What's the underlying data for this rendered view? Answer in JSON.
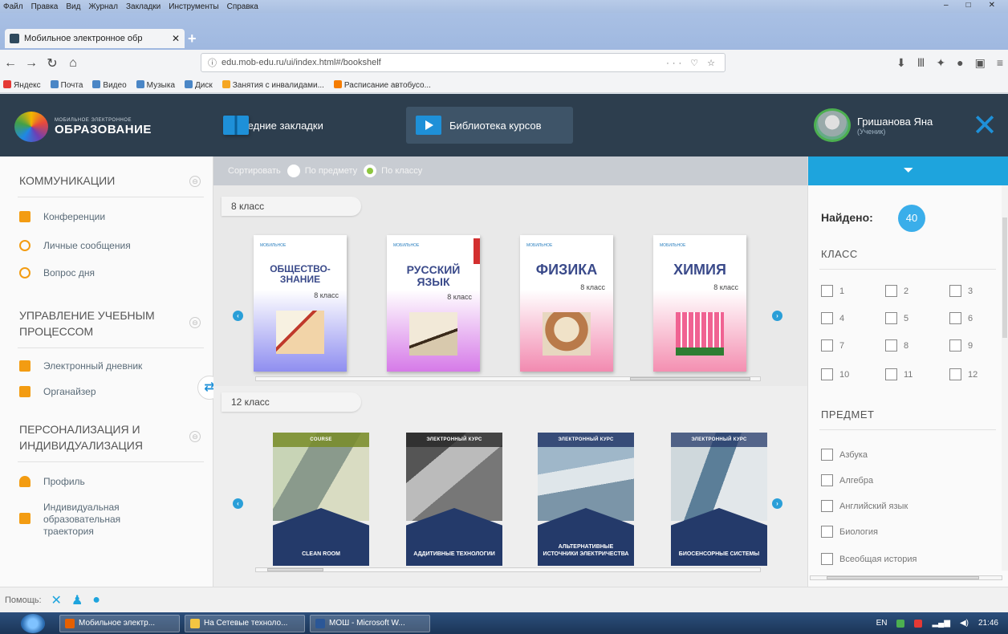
{
  "browser": {
    "menu": [
      "Файл",
      "Правка",
      "Вид",
      "Журнал",
      "Закладки",
      "Инструменты",
      "Справка"
    ],
    "tab_title": "Мобильное электронное обр",
    "url": "edu.mob-edu.ru/ui/index.html#/bookshelf",
    "bookmarks": [
      "Яндекс",
      "Почта",
      "Видео",
      "Музыка",
      "Диск",
      "Занятия с инвалидами...",
      "Расписание автобусо..."
    ]
  },
  "app": {
    "logo_small": "МОБИЛЬНОЕ ЭЛЕКТРОННОЕ",
    "logo_big": "ОБРАЗОВАНИЕ",
    "nav_recent": "Последние закладки",
    "nav_library": "Библиотека курсов",
    "user_name": "Гришанова Яна",
    "user_role": "(Ученик)"
  },
  "sidebar": {
    "sec1": "КОММУНИКАЦИИ",
    "conferences": "Конференции",
    "messages": "Личные сообщения",
    "question": "Вопрос дня",
    "sec2_l1": "УПРАВЛЕНИЕ УЧЕБНЫМ",
    "sec2_l2": "ПРОЦЕССОМ",
    "diary": "Электронный дневник",
    "organizer": "Органайзер",
    "sec3_l1": "ПЕРСОНАЛИЗАЦИЯ И",
    "sec3_l2": "ИНДИВИДУАЛИЗАЦИЯ",
    "profile": "Профиль",
    "trajectory_l1": "Индивидуальная",
    "trajectory_l2": "образовательная",
    "trajectory_l3": "траектория"
  },
  "sort": {
    "label": "Сортировать",
    "by_subject": "По предмету",
    "by_class": "По классу"
  },
  "shelves": {
    "grade8": {
      "label": "8 класс",
      "books": [
        {
          "l1": "ОБЩЕСТВО-",
          "l2": "ЗНАНИЕ",
          "grade": "8 класс",
          "pub": "МОБИЛЬНОЕ"
        },
        {
          "l1": "РУССКИЙ",
          "l2": "ЯЗЫК",
          "grade": "8 класс",
          "pub": "МОБИЛЬНОЕ"
        },
        {
          "l1": "ФИЗИКА",
          "l2": "",
          "grade": "8 класс",
          "pub": "МОБИЛЬНОЕ"
        },
        {
          "l1": "ХИМИЯ",
          "l2": "",
          "grade": "8 класс",
          "pub": "МОБИЛЬНОЕ"
        }
      ]
    },
    "grade12": {
      "label": "12 класс",
      "courses": [
        {
          "top": "COURSE",
          "title": "CLEAN ROOM"
        },
        {
          "top": "ЭЛЕКТРОННЫЙ КУРС",
          "title": "АДДИТИВНЫЕ ТЕХНОЛОГИИ"
        },
        {
          "top": "ЭЛЕКТРОННЫЙ КУРС",
          "title": "АЛЬТЕРНАТИВНЫЕ ИСТОЧНИКИ ЭЛЕКТРИЧЕСТВА"
        },
        {
          "top": "ЭЛЕКТРОННЫЙ КУРС",
          "title": "БИОСЕНСОРНЫЕ СИСТЕМЫ"
        }
      ]
    }
  },
  "filters": {
    "found_label": "Найдено:",
    "found_count": "40",
    "class_title": "КЛАСС",
    "classes": [
      "1",
      "2",
      "3",
      "4",
      "5",
      "6",
      "7",
      "8",
      "9",
      "10",
      "11",
      "12"
    ],
    "subject_title": "ПРЕДМЕТ",
    "subjects": [
      "Азбука",
      "Алгебра",
      "Английский язык",
      "Биология",
      "Всеобщая история"
    ]
  },
  "footer": {
    "help": "Помощь:"
  },
  "taskbar": {
    "tasks": [
      "Мобильное электр...",
      "На Сетевые техноло...",
      "МОШ - Microsoft W..."
    ],
    "lang": "EN",
    "time": "21:46"
  },
  "colors": {
    "header_bg": "#2d3e4e",
    "accent": "#1ea4dd",
    "sortbar": "#c8ccd2"
  }
}
